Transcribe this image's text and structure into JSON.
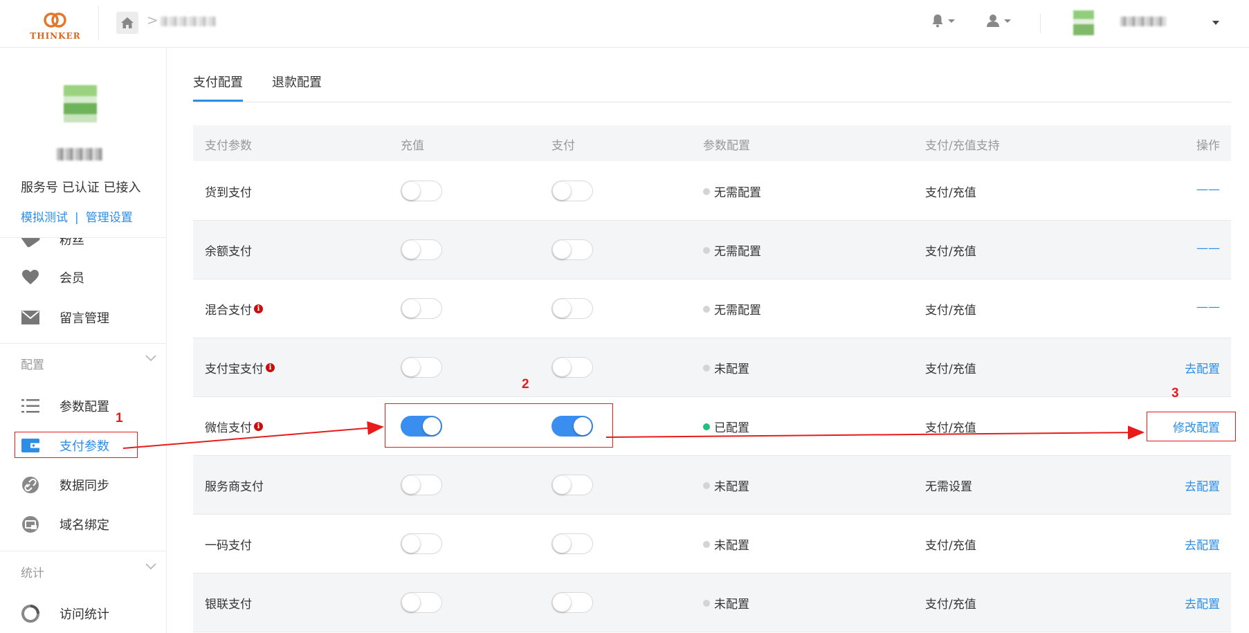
{
  "header": {
    "brand": "THINKER",
    "icons": [
      "bell-icon",
      "user-icon"
    ]
  },
  "sidebar": {
    "profile": {
      "status": "服务号 已认证 已接入",
      "link_test": "模拟测试",
      "link_sep": "|",
      "link_manage": "管理设置"
    },
    "partial_item": "粉丝",
    "items_top": [
      {
        "label": "会员",
        "icon": "heart-icon"
      },
      {
        "label": "留言管理",
        "icon": "mail-icon"
      }
    ],
    "section_config": {
      "label": "配置",
      "items": [
        {
          "label": "参数配置",
          "icon": "list-icon"
        },
        {
          "label": "支付参数",
          "icon": "wallet-icon",
          "active": true
        },
        {
          "label": "数据同步",
          "icon": "link-icon"
        },
        {
          "label": "域名绑定",
          "icon": "domain-icon"
        }
      ]
    },
    "section_stats": {
      "label": "统计",
      "items": [
        {
          "label": "访问统计",
          "icon": "chart-icon"
        }
      ]
    }
  },
  "main": {
    "tabs": [
      {
        "label": "支付配置",
        "active": true
      },
      {
        "label": "退款配置",
        "active": false
      }
    ],
    "table": {
      "headers": [
        "支付参数",
        "充值",
        "支付",
        "参数配置",
        "支付/充值支持",
        "操作"
      ],
      "rows": [
        {
          "name": "货到支付",
          "info": false,
          "recharge": false,
          "pay": false,
          "config": "无需配置",
          "configured": false,
          "support": "支付/充值",
          "action": "——"
        },
        {
          "name": "余额支付",
          "info": false,
          "recharge": false,
          "pay": false,
          "config": "无需配置",
          "configured": false,
          "support": "支付/充值",
          "action": "——"
        },
        {
          "name": "混合支付",
          "info": true,
          "recharge": false,
          "pay": false,
          "config": "无需配置",
          "configured": false,
          "support": "支付/充值",
          "action": "——"
        },
        {
          "name": "支付宝支付",
          "info": true,
          "recharge": false,
          "pay": false,
          "config": "未配置",
          "configured": false,
          "support": "支付/充值",
          "action": "去配置"
        },
        {
          "name": "微信支付",
          "info": true,
          "recharge": true,
          "pay": true,
          "config": "已配置",
          "configured": true,
          "support": "支付/充值",
          "action": "修改配置"
        },
        {
          "name": "服务商支付",
          "info": false,
          "recharge": false,
          "pay": false,
          "config": "未配置",
          "configured": false,
          "support": "无需设置",
          "action": "去配置"
        },
        {
          "name": "一码支付",
          "info": false,
          "recharge": false,
          "pay": false,
          "config": "未配置",
          "configured": false,
          "support": "支付/充值",
          "action": "去配置"
        },
        {
          "name": "银联支付",
          "info": false,
          "recharge": false,
          "pay": false,
          "config": "未配置",
          "configured": false,
          "support": "支付/充值",
          "action": "去配置"
        }
      ]
    }
  },
  "annotations": [
    "1",
    "2",
    "3"
  ],
  "colors": {
    "accent": "#2c8ee6",
    "toggle_on": "#3a8ef0",
    "annotation": "#e81a1a",
    "ok_dot": "#1ec27a"
  }
}
